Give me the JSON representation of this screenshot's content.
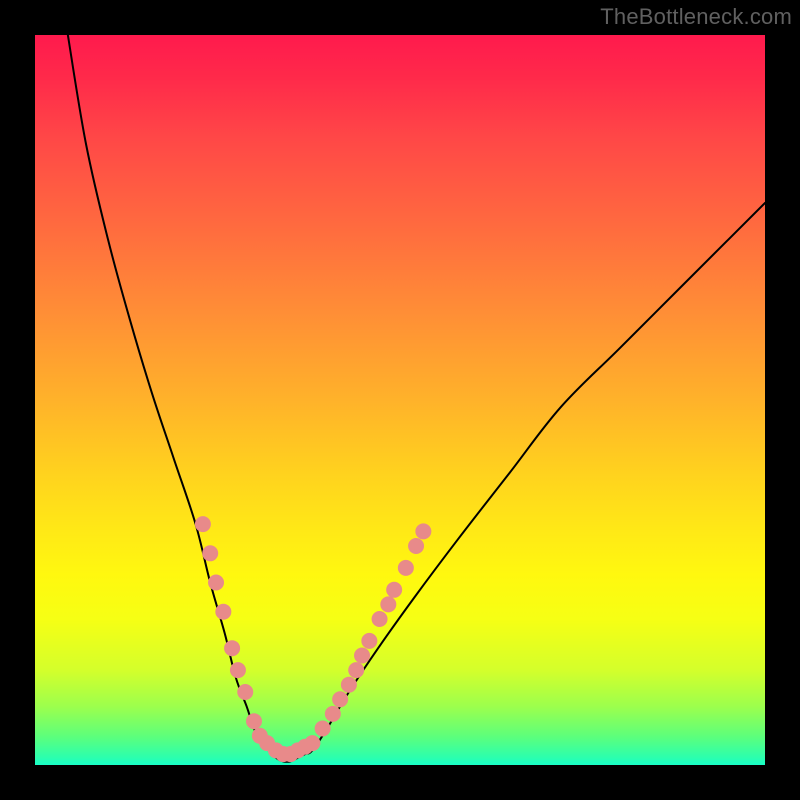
{
  "watermark": "TheBottleneck.com",
  "chart_data": {
    "type": "line",
    "title": "",
    "xlabel": "",
    "ylabel": "",
    "xlim": [
      0,
      100
    ],
    "ylim": [
      0,
      100
    ],
    "gradient_stops": [
      {
        "pos": 0,
        "color": "#ff1a4d"
      },
      {
        "pos": 14,
        "color": "#ff4747"
      },
      {
        "pos": 38,
        "color": "#ff8e36"
      },
      {
        "pos": 60,
        "color": "#ffd21e"
      },
      {
        "pos": 80,
        "color": "#f6ff14"
      },
      {
        "pos": 96,
        "color": "#5eff7a"
      },
      {
        "pos": 100,
        "color": "#18ffc8"
      }
    ],
    "series": [
      {
        "name": "left-branch",
        "x": [
          4.5,
          7,
          10,
          13,
          16,
          19,
          22,
          24,
          26,
          27.5,
          29,
          30,
          31,
          32
        ],
        "y": [
          100,
          85,
          72,
          61,
          51,
          42,
          33,
          25,
          18,
          12,
          8,
          5,
          3,
          2
        ]
      },
      {
        "name": "valley",
        "x": [
          32,
          33,
          34,
          35,
          36,
          37,
          38
        ],
        "y": [
          2,
          1,
          0.5,
          0.5,
          1,
          1.5,
          2
        ]
      },
      {
        "name": "right-branch",
        "x": [
          38,
          40,
          43,
          47,
          52,
          58,
          65,
          72,
          80,
          88,
          95,
          100
        ],
        "y": [
          2,
          5,
          10,
          16,
          23,
          31,
          40,
          49,
          57,
          65,
          72,
          77
        ]
      }
    ],
    "highlight_dots": {
      "color": "#e88a8a",
      "radius_px": 8,
      "points": [
        {
          "x": 23.0,
          "y": 33
        },
        {
          "x": 24.0,
          "y": 29
        },
        {
          "x": 24.8,
          "y": 25
        },
        {
          "x": 25.8,
          "y": 21
        },
        {
          "x": 27.0,
          "y": 16
        },
        {
          "x": 27.8,
          "y": 13
        },
        {
          "x": 28.8,
          "y": 10
        },
        {
          "x": 30.0,
          "y": 6
        },
        {
          "x": 30.8,
          "y": 4
        },
        {
          "x": 31.8,
          "y": 3
        },
        {
          "x": 33.0,
          "y": 2
        },
        {
          "x": 34.0,
          "y": 1.5
        },
        {
          "x": 35.0,
          "y": 1.5
        },
        {
          "x": 36.0,
          "y": 2
        },
        {
          "x": 37.0,
          "y": 2.5
        },
        {
          "x": 38.0,
          "y": 3
        },
        {
          "x": 39.4,
          "y": 5
        },
        {
          "x": 40.8,
          "y": 7
        },
        {
          "x": 41.8,
          "y": 9
        },
        {
          "x": 43.0,
          "y": 11
        },
        {
          "x": 44.0,
          "y": 13
        },
        {
          "x": 44.8,
          "y": 15
        },
        {
          "x": 45.8,
          "y": 17
        },
        {
          "x": 47.2,
          "y": 20
        },
        {
          "x": 48.4,
          "y": 22
        },
        {
          "x": 49.2,
          "y": 24
        },
        {
          "x": 50.8,
          "y": 27
        },
        {
          "x": 52.2,
          "y": 30
        },
        {
          "x": 53.2,
          "y": 32
        }
      ]
    }
  }
}
